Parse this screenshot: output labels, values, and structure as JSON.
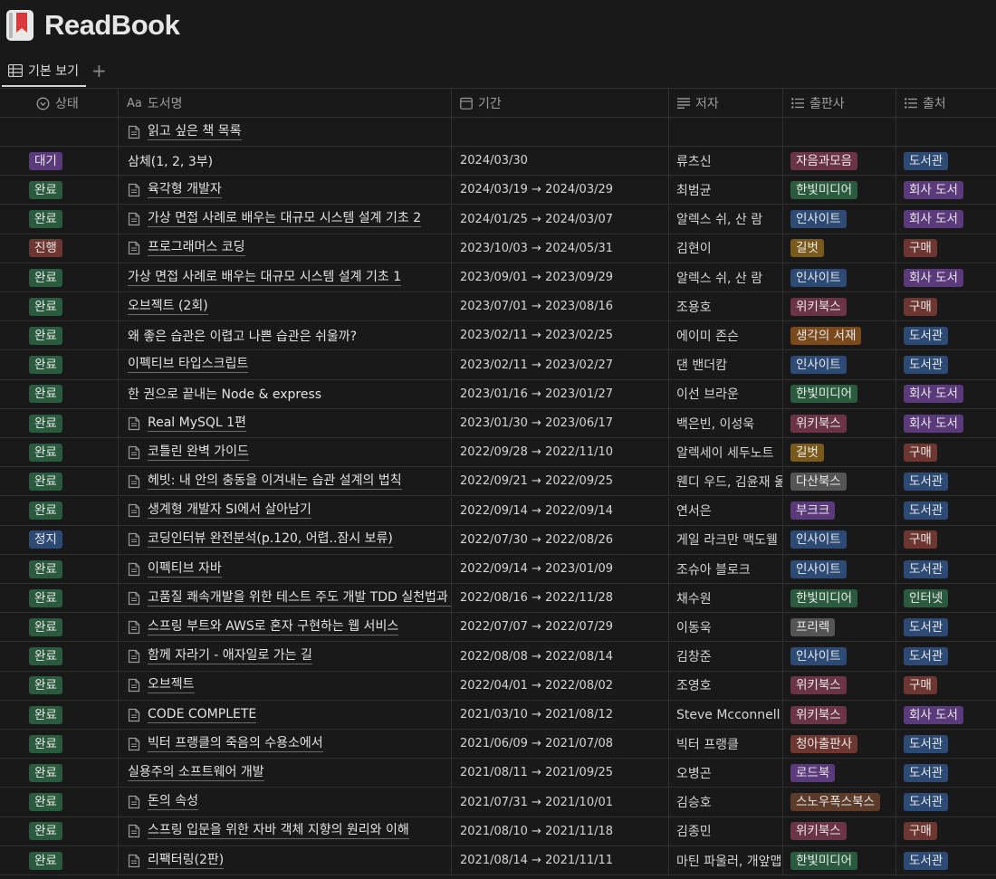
{
  "app": {
    "title": "ReadBook"
  },
  "tabs": {
    "active_label": "기본 보기",
    "add_symbol": "+"
  },
  "columns": {
    "status": "상태",
    "aa": "Aa",
    "title": "도서명",
    "period": "기간",
    "author": "저자",
    "publisher": "출판사",
    "source": "출처"
  },
  "colors": {
    "bg": "#191919",
    "tag": {
      "purple": "#5a3a7a",
      "green": "#2b5b3f",
      "red": "#6e3630",
      "blue": "#2c4a74",
      "brown": "#5c3b2a",
      "pink": "#6b3346",
      "orange": "#7a4a1c",
      "yellow": "#7a5a1a",
      "gray": "#545454"
    }
  },
  "rows": [
    {
      "status": "",
      "status_color": "",
      "title": "읽고 싶은 책 목록",
      "icon": true,
      "link": true,
      "period": "",
      "author": "",
      "publisher": "",
      "publisher_color": "",
      "source": "",
      "source_color": ""
    },
    {
      "status": "대기",
      "status_color": "purple",
      "title": "삼체(1, 2, 3부)",
      "icon": false,
      "link": false,
      "period": "2024/03/30",
      "author": "류츠신",
      "publisher": "자음과모음",
      "publisher_color": "pink",
      "source": "도서관",
      "source_color": "blue"
    },
    {
      "status": "완료",
      "status_color": "green",
      "title": "육각형 개발자",
      "icon": true,
      "link": true,
      "period": "2024/03/19 → 2024/03/29",
      "author": "최범균",
      "publisher": "한빛미디어",
      "publisher_color": "green",
      "source": "회사 도서",
      "source_color": "purple"
    },
    {
      "status": "완료",
      "status_color": "green",
      "title": "가상 면접 사례로 배우는 대규모 시스템 설계 기초 2",
      "icon": true,
      "link": true,
      "period": "2024/01/25 → 2024/03/07",
      "author": "알렉스 쉬, 산 람",
      "publisher": "인사이트",
      "publisher_color": "blue",
      "source": "회사 도서",
      "source_color": "purple"
    },
    {
      "status": "진행",
      "status_color": "red",
      "title": "프로그래머스 코딩",
      "icon": true,
      "link": true,
      "period": "2023/10/03 → 2024/05/31",
      "author": "김현이",
      "publisher": "길벗",
      "publisher_color": "yellow",
      "source": "구매",
      "source_color": "red"
    },
    {
      "status": "완료",
      "status_color": "green",
      "title": "가상 면접 사례로 배우는 대규모 시스템 설계 기초 1",
      "icon": false,
      "link": true,
      "period": "2023/09/01 → 2023/09/29",
      "author": "알렉스 쉬, 산 람",
      "publisher": "인사이트",
      "publisher_color": "blue",
      "source": "회사 도서",
      "source_color": "purple"
    },
    {
      "status": "완료",
      "status_color": "green",
      "title": "오브젝트 (2회)",
      "icon": false,
      "link": true,
      "period": "2023/07/01 → 2023/08/16",
      "author": "조용호",
      "publisher": "위키북스",
      "publisher_color": "pink",
      "source": "구매",
      "source_color": "red"
    },
    {
      "status": "완료",
      "status_color": "green",
      "title": "왜 좋은 습관은 이렵고 나쁜 습관은 쉬울까?",
      "icon": false,
      "link": false,
      "period": "2023/02/11 → 2023/02/25",
      "author": "에이미 존슨",
      "publisher": "생각의 서재",
      "publisher_color": "orange",
      "source": "도서관",
      "source_color": "blue"
    },
    {
      "status": "완료",
      "status_color": "green",
      "title": "이펙티브 타입스크립트",
      "icon": false,
      "link": true,
      "period": "2023/02/11 → 2023/02/27",
      "author": "댄 밴더캄",
      "publisher": "인사이트",
      "publisher_color": "blue",
      "source": "도서관",
      "source_color": "blue"
    },
    {
      "status": "완료",
      "status_color": "green",
      "title": "한 권으로 끝내는 Node & express",
      "icon": false,
      "link": false,
      "period": "2023/01/16 → 2023/01/27",
      "author": "이선 브라운",
      "publisher": "한빛미디어",
      "publisher_color": "green",
      "source": "회사 도서",
      "source_color": "purple"
    },
    {
      "status": "완료",
      "status_color": "green",
      "title": "Real MySQL 1편",
      "icon": true,
      "link": true,
      "period": "2023/01/30 → 2023/06/17",
      "author": "백은빈, 이성욱",
      "publisher": "위키북스",
      "publisher_color": "pink",
      "source": "회사 도서",
      "source_color": "purple"
    },
    {
      "status": "완료",
      "status_color": "green",
      "title": "코틀린 완벽 가이드",
      "icon": true,
      "link": true,
      "period": "2022/09/28 → 2022/11/10",
      "author": "알렉세이 세두노트",
      "publisher": "길벗",
      "publisher_color": "yellow",
      "source": "구매",
      "source_color": "red"
    },
    {
      "status": "완료",
      "status_color": "green",
      "title": "헤빗: 내 안의 충동을 이겨내는 습관 설계의 법칙",
      "icon": true,
      "link": true,
      "period": "2022/09/21 → 2022/09/25",
      "author": "웬디 우드, 김윤재 옮",
      "publisher": "다산북스",
      "publisher_color": "gray",
      "source": "도서관",
      "source_color": "blue"
    },
    {
      "status": "완료",
      "status_color": "green",
      "title": "생계형 개발자 SI에서 살아남기",
      "icon": true,
      "link": true,
      "period": "2022/09/14 → 2022/09/14",
      "author": "연서은",
      "publisher": "부크크",
      "publisher_color": "purple",
      "source": "도서관",
      "source_color": "blue"
    },
    {
      "status": "정지",
      "status_color": "blue",
      "title": "코딩인터뷰 완전분석(p.120, 어렵..잠시 보류)",
      "icon": true,
      "link": true,
      "period": "2022/07/30 → 2022/08/26",
      "author": "게일 라크만 맥도웰",
      "publisher": "인사이트",
      "publisher_color": "blue",
      "source": "구매",
      "source_color": "red"
    },
    {
      "status": "완료",
      "status_color": "green",
      "title": "이펙티브 자바",
      "icon": true,
      "link": true,
      "period": "2022/09/14 → 2023/01/09",
      "author": "조슈아 블로크",
      "publisher": "인사이트",
      "publisher_color": "blue",
      "source": "도서관",
      "source_color": "blue"
    },
    {
      "status": "완료",
      "status_color": "green",
      "title": "고품질 쾌속개발을 위한 테스트 주도 개발 TDD 실천법과 도구",
      "icon": true,
      "link": true,
      "period": "2022/08/16 → 2022/11/28",
      "author": "채수원",
      "publisher": "한빛미디어",
      "publisher_color": "green",
      "source": "인터넷",
      "source_color": "green"
    },
    {
      "status": "완료",
      "status_color": "green",
      "title": "스프링 부트와 AWS로 혼자 구현하는 웹 서비스",
      "icon": true,
      "link": true,
      "period": "2022/07/07 → 2022/07/29",
      "author": "이동욱",
      "publisher": "프리렉",
      "publisher_color": "gray",
      "source": "도서관",
      "source_color": "blue"
    },
    {
      "status": "완료",
      "status_color": "green",
      "title": "함께 자라기 - 애자일로 가는 길",
      "icon": true,
      "link": true,
      "period": "2022/08/08 → 2022/08/14",
      "author": "김창준",
      "publisher": "인사이트",
      "publisher_color": "blue",
      "source": "도서관",
      "source_color": "blue"
    },
    {
      "status": "완료",
      "status_color": "green",
      "title": "오브젝트",
      "icon": true,
      "link": true,
      "period": "2022/04/01 → 2022/08/02",
      "author": "조영호",
      "publisher": "위키북스",
      "publisher_color": "pink",
      "source": "구매",
      "source_color": "red"
    },
    {
      "status": "완료",
      "status_color": "green",
      "title": "CODE COMPLETE",
      "icon": true,
      "link": true,
      "period": "2021/03/10 → 2021/08/12",
      "author": "Steve Mcconnell",
      "publisher": "위키북스",
      "publisher_color": "pink",
      "source": "회사 도서",
      "source_color": "purple"
    },
    {
      "status": "완료",
      "status_color": "green",
      "title": "빅터 프랭클의 죽음의 수용소에서",
      "icon": true,
      "link": true,
      "period": "2021/06/09 → 2021/07/08",
      "author": "빅터 프랭클",
      "publisher": "청아출판사",
      "publisher_color": "red",
      "source": "도서관",
      "source_color": "blue"
    },
    {
      "status": "완료",
      "status_color": "green",
      "title": "실용주의 소프트웨어 개발",
      "icon": false,
      "link": true,
      "period": "2021/08/11 → 2021/09/25",
      "author": "오병곤",
      "publisher": "로드북",
      "publisher_color": "purple",
      "source": "도서관",
      "source_color": "blue"
    },
    {
      "status": "완료",
      "status_color": "green",
      "title": "돈의 속성",
      "icon": true,
      "link": true,
      "period": "2021/07/31 → 2021/10/01",
      "author": "김승호",
      "publisher": "스노우폭스북스",
      "publisher_color": "brown",
      "source": "도서관",
      "source_color": "blue"
    },
    {
      "status": "완료",
      "status_color": "green",
      "title": "스프링 입문을 위한 자바 객체 지향의 원리와 이해",
      "icon": true,
      "link": true,
      "period": "2021/08/10 → 2021/11/18",
      "author": "김종민",
      "publisher": "위키북스",
      "publisher_color": "pink",
      "source": "구매",
      "source_color": "red"
    },
    {
      "status": "완료",
      "status_color": "green",
      "title": "리팩터링(2판)",
      "icon": true,
      "link": true,
      "period": "2021/08/14 → 2021/11/11",
      "author": "마틴 파울러, 개앞맵",
      "publisher": "한빛미디어",
      "publisher_color": "green",
      "source": "도서관",
      "source_color": "blue"
    }
  ]
}
